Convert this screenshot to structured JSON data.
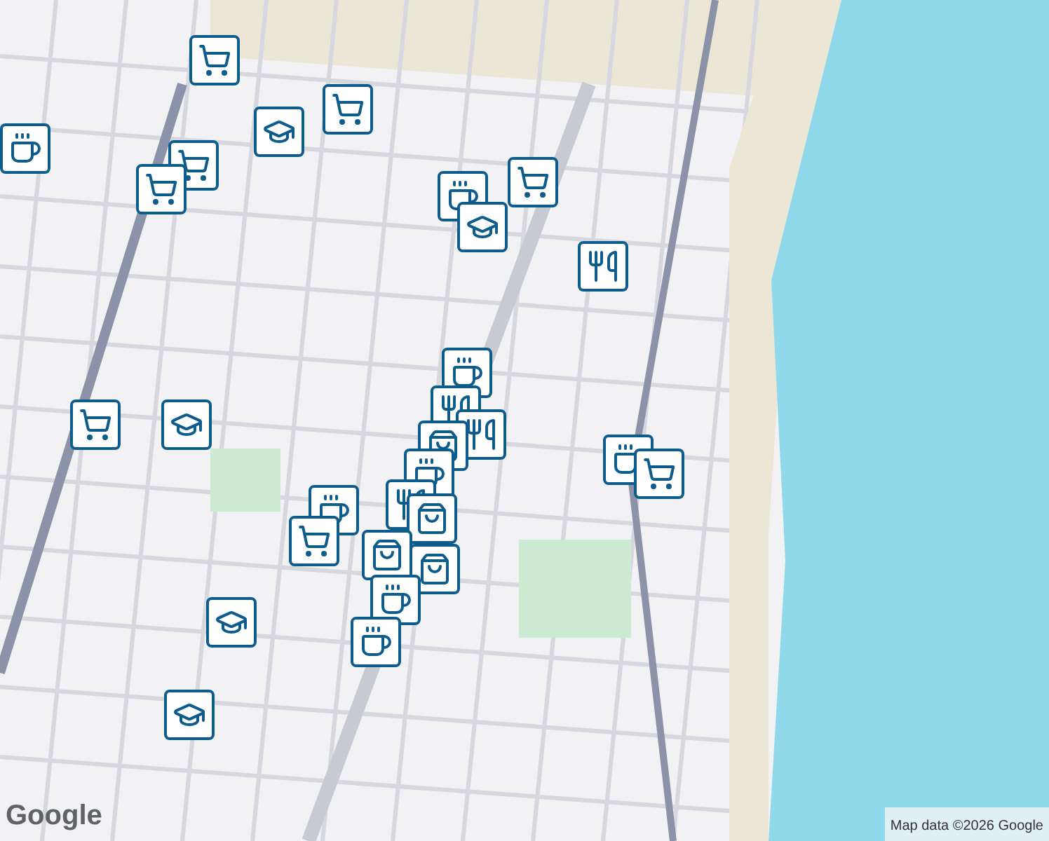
{
  "markers": [
    {
      "kind": "cart"
    },
    {
      "kind": "school"
    },
    {
      "kind": "cart"
    },
    {
      "kind": "cup"
    },
    {
      "kind": "cart"
    },
    {
      "kind": "cart"
    },
    {
      "kind": "cart"
    },
    {
      "kind": "cup"
    },
    {
      "kind": "school"
    },
    {
      "kind": "fork"
    },
    {
      "kind": "cup"
    },
    {
      "kind": "fork"
    },
    {
      "kind": "fork"
    },
    {
      "kind": "bag"
    },
    {
      "kind": "cart"
    },
    {
      "kind": "school"
    },
    {
      "kind": "cup"
    },
    {
      "kind": "cup"
    },
    {
      "kind": "cart"
    },
    {
      "kind": "fork"
    },
    {
      "kind": "bag"
    },
    {
      "kind": "cup"
    },
    {
      "kind": "cart"
    },
    {
      "kind": "bag"
    },
    {
      "kind": "bag"
    },
    {
      "kind": "cup"
    },
    {
      "kind": "cup"
    },
    {
      "kind": "school"
    },
    {
      "kind": "school"
    }
  ],
  "logo": "Google",
  "attribution": "Map data ©2026 Google"
}
